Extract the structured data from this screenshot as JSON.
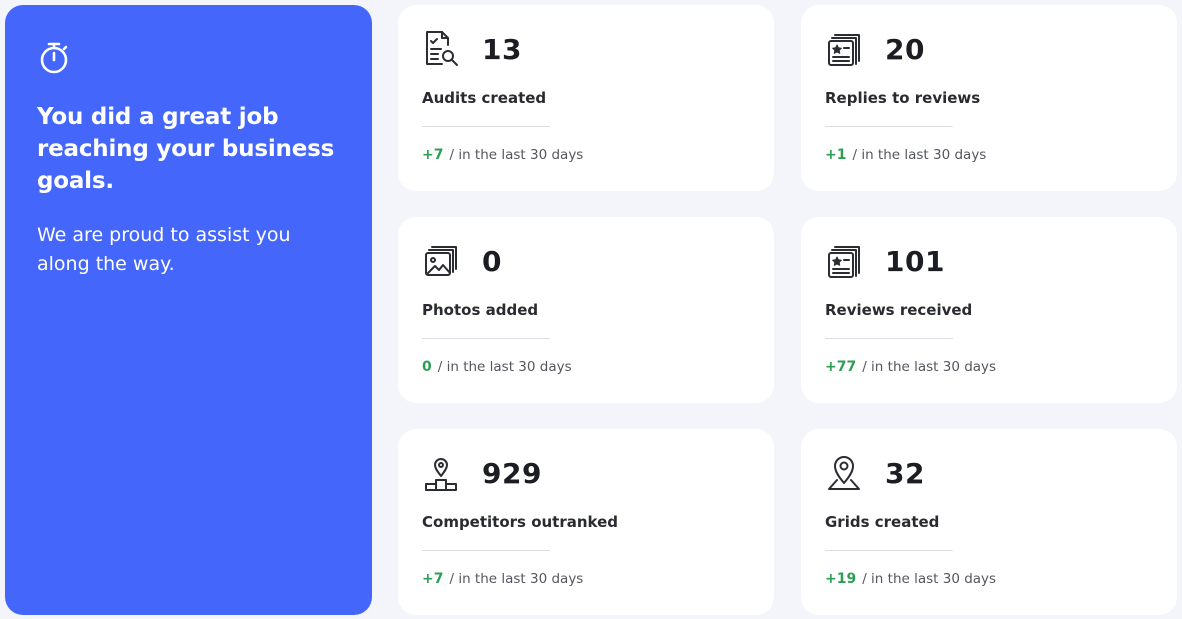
{
  "hero": {
    "headline": "You did a great job reaching your business goals.",
    "subtext": "We are proud to assist you along the way.",
    "icon": "stopwatch-icon"
  },
  "cards": [
    {
      "icon": "audit-document-icon",
      "value": "13",
      "label": "Audits created",
      "delta": "+7",
      "period": "/ in the last 30 days"
    },
    {
      "icon": "review-replies-icon",
      "value": "20",
      "label": "Replies to reviews",
      "delta": "+1",
      "period": "/ in the last 30 days"
    },
    {
      "icon": "photos-icon",
      "value": "0",
      "label": "Photos added",
      "delta": "0",
      "period": "/ in the last 30 days"
    },
    {
      "icon": "reviews-received-icon",
      "value": "101",
      "label": "Reviews received",
      "delta": "+77",
      "period": "/ in the last 30 days"
    },
    {
      "icon": "podium-pin-icon",
      "value": "929",
      "label": "Competitors outranked",
      "delta": "+7",
      "period": "/ in the last 30 days"
    },
    {
      "icon": "map-pin-icon",
      "value": "32",
      "label": "Grids created",
      "delta": "+19",
      "period": "/ in the last 30 days"
    }
  ],
  "colors": {
    "accent": "#4466fb",
    "positive": "#2e9e55",
    "background": "#f3f5fa"
  }
}
